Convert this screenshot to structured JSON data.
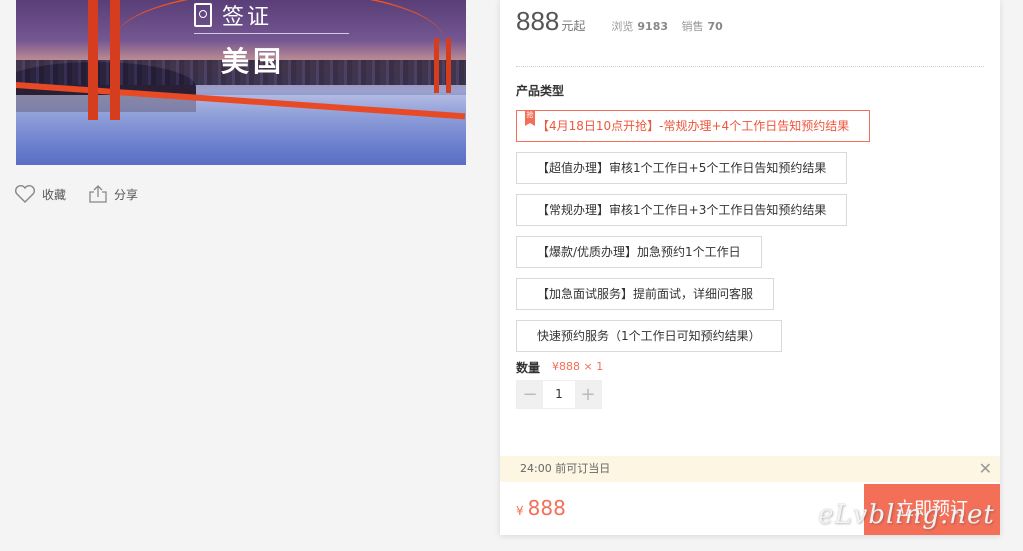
{
  "hero": {
    "visa_label": "签证",
    "country": "美国"
  },
  "actions": {
    "favorite": "收藏",
    "share": "分享"
  },
  "product": {
    "price": "888",
    "price_unit": "元起",
    "views_label": "浏览",
    "views": "9183",
    "sales_label": "销售",
    "sales": "70"
  },
  "product_type": {
    "title": "产品类型",
    "options": [
      {
        "label": "【4月18日10点开抢】-常规办理+4个工作日告知预约结果",
        "selected": true,
        "tag": "抢"
      },
      {
        "label": "【超值办理】审核1个工作日+5个工作日告知预约结果",
        "selected": false
      },
      {
        "label": "【常规办理】审核1个工作日+3个工作日告知预约结果",
        "selected": false
      },
      {
        "label": "【爆款/优质办理】加急预约1个工作日",
        "selected": false
      },
      {
        "label": "【加急面试服务】提前面试，详细问客服",
        "selected": false
      },
      {
        "label": "快速预约服务（1个工作日可知预约结果）",
        "selected": false
      }
    ]
  },
  "quantity": {
    "label": "数量",
    "summary": "¥888 × 1",
    "value": "1",
    "minus": "−",
    "plus": "+"
  },
  "notice": {
    "text": "24:00 前可订当日",
    "close": "✕"
  },
  "buy": {
    "currency": "¥",
    "price": "888",
    "button": "立即预订"
  },
  "watermark": "eLvbling.net",
  "colors": {
    "accent": "#f36f58",
    "notice_bg": "#fdf6e3"
  }
}
